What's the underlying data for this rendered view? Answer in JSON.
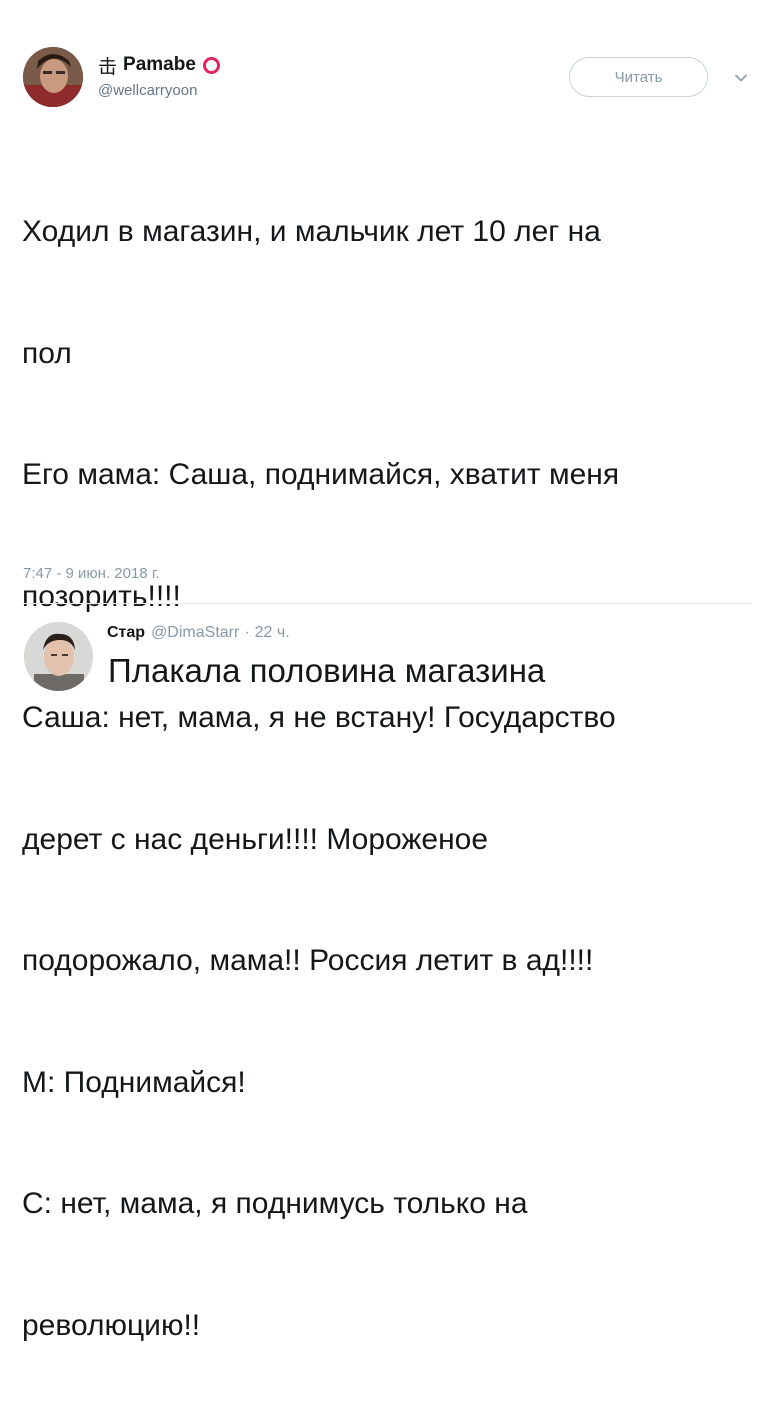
{
  "tweet": {
    "author": {
      "name_glyph": "击",
      "name": "Pamabe",
      "handle": "@wellcarryoon"
    },
    "follow_label": "Читать",
    "text_lines": [
      "Ходил в магазин, и мальчик лет 10 лег на",
      "пол",
      "Его мама: Саша, поднимайся, хватит меня",
      "позорить!!!!",
      "Саша: нет, мама, я не встану! Государство",
      "дерет с нас деньги!!!! Мороженое",
      "подорожало, мама!! Россия летит в ад!!!!",
      "М: Поднимайся!",
      "С: нет, мама, я поднимусь только на",
      "революцию!!"
    ],
    "timestamp": "7:47 - 9 июн. 2018 г."
  },
  "reply": {
    "name": "Стар",
    "handle": "@DimaStarr",
    "separator": "·",
    "time": "22 ч.",
    "text": "Плакала половина магазина"
  },
  "icons": {
    "verified_ring": "red-ring-icon",
    "more": "chevron-down-icon"
  },
  "colors": {
    "text": "#14171a",
    "secondary": "#8899a6",
    "accent_ring": "#e0245e",
    "button_border": "#c8d2da",
    "divider": "#e6ecf0"
  }
}
